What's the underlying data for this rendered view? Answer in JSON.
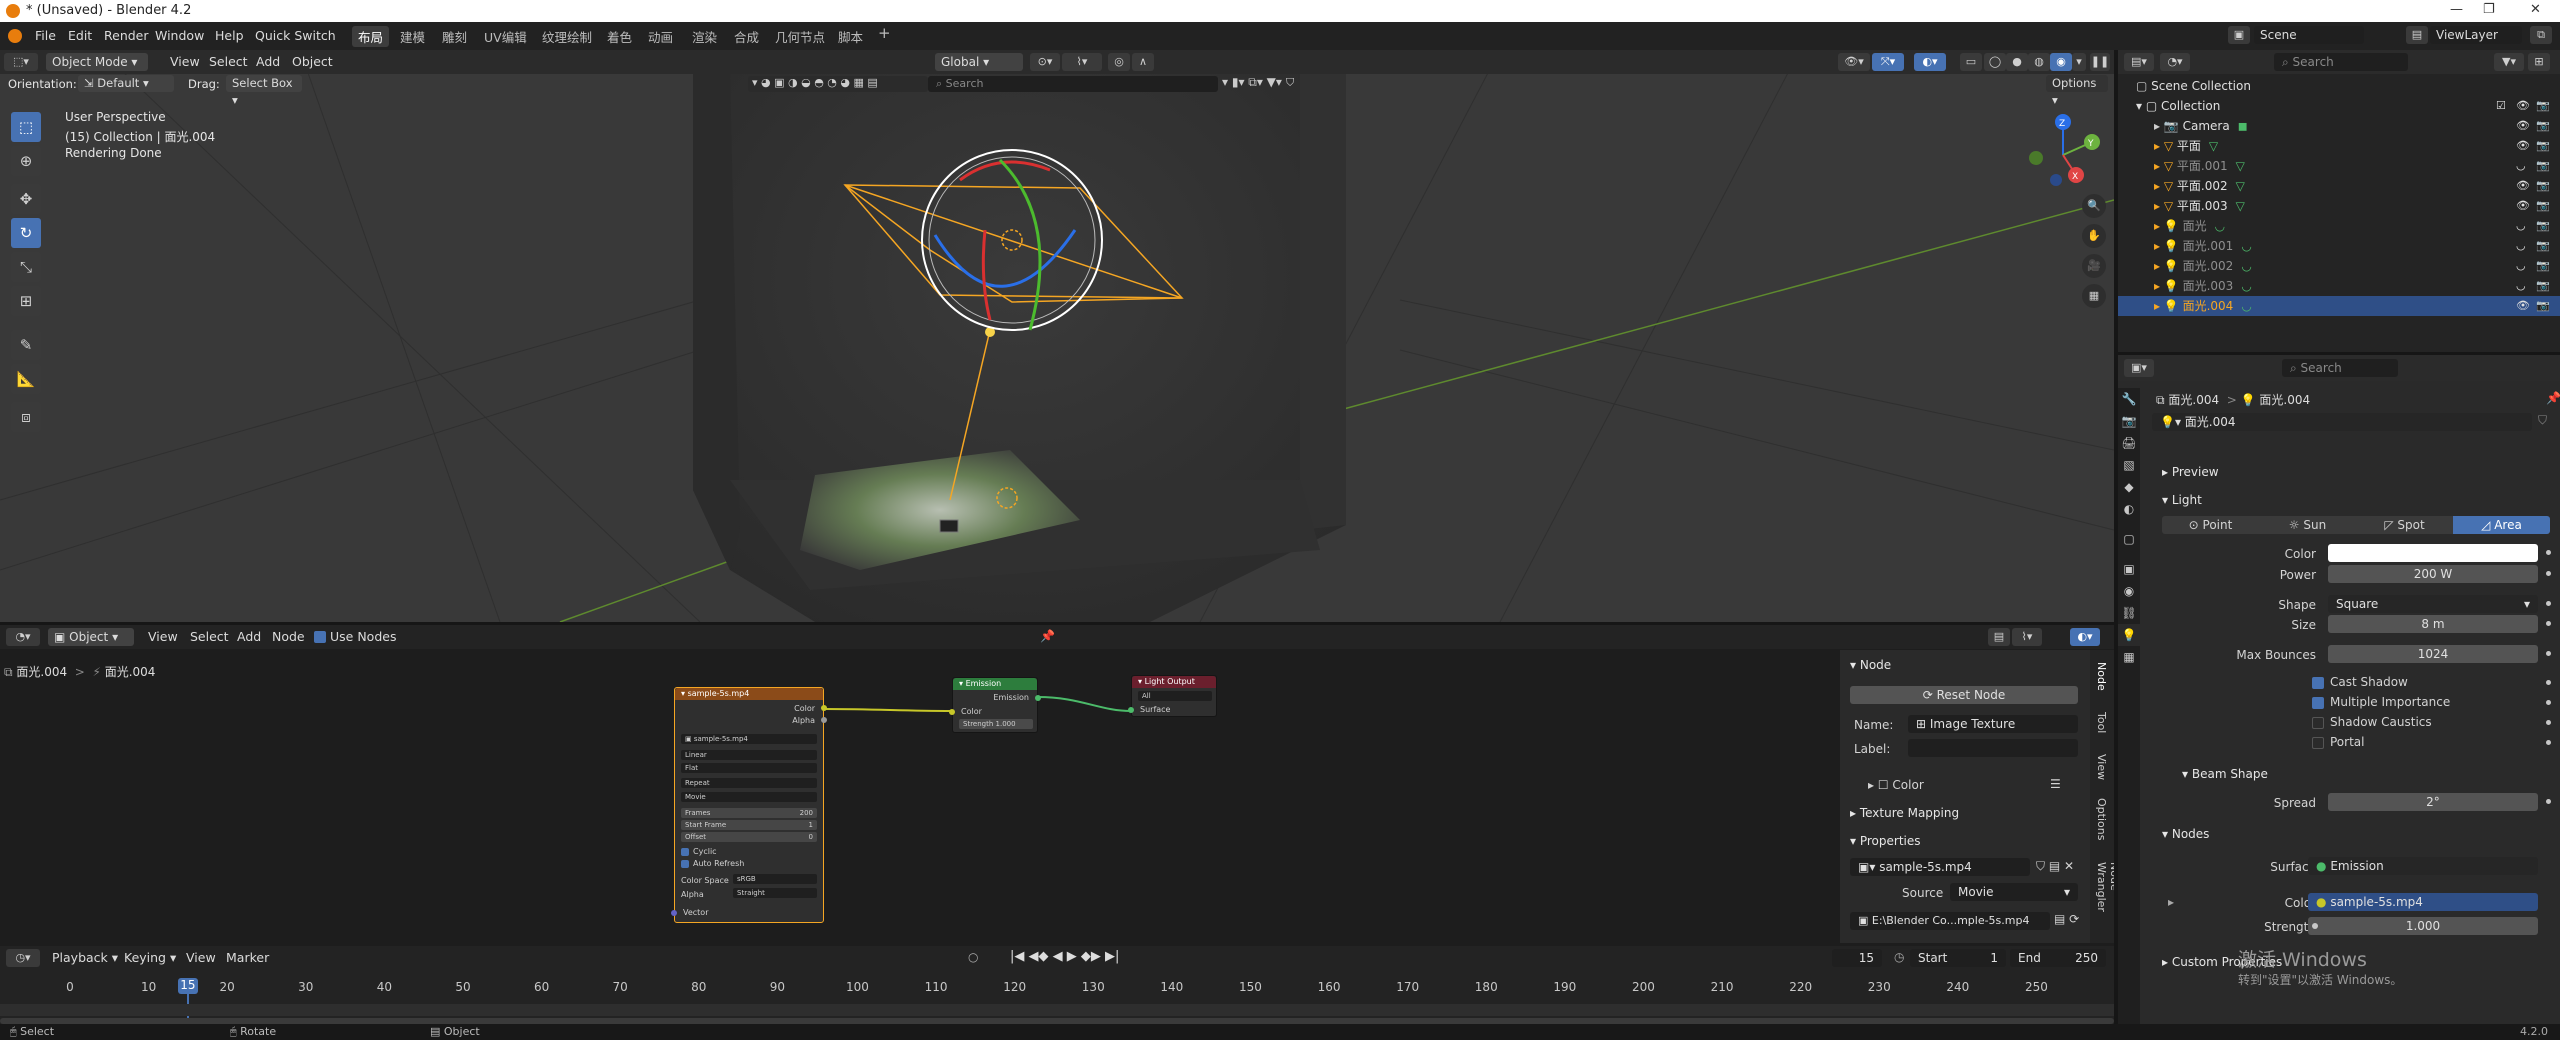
{
  "window": {
    "title": "* (Unsaved) - Blender 4.2"
  },
  "menubar": {
    "items": [
      "File",
      "Edit",
      "Render",
      "Window",
      "Help",
      "Quick Switch"
    ],
    "workspaces": [
      "布局",
      "建模",
      "雕刻",
      "UV编辑",
      "纹理绘制",
      "着色",
      "动画",
      "渲染",
      "合成",
      "几何节点",
      "脚本"
    ],
    "add_workspace": "+"
  },
  "viewport": {
    "mode": "Object Mode",
    "menus": [
      "View",
      "Select",
      "Add",
      "Object"
    ],
    "orientation_label": "Orientation:",
    "orientation_value": "Default",
    "drag_label": "Drag:",
    "drag_value": "Select Box",
    "transform_space": "Global",
    "search_placeholder": "Search",
    "options_label": "Options",
    "info_line1": "User Perspective",
    "info_line2": "(15) Collection | 面光.004",
    "info_line3": "Rendering Done",
    "axes": {
      "x": "X",
      "y": "Y",
      "z": "Z"
    }
  },
  "node_editor": {
    "object_mode": "Object",
    "menus": [
      "View",
      "Select",
      "Add",
      "Node"
    ],
    "use_nodes_label": "Use Nodes",
    "breadcrumb": [
      "面光.004",
      "面光.004"
    ],
    "image_node": {
      "title": "sample-5s.mp4",
      "outputs": [
        "Color",
        "Alpha"
      ],
      "image_name": "sample-5s.mp4",
      "interpolation": "Linear",
      "projection": "Flat",
      "extension": "Repeat",
      "source": "Movie",
      "frames_label": "Frames",
      "frames_value": "200",
      "start_frame_label": "Start Frame",
      "start_frame_value": "1",
      "offset_label": "Offset",
      "offset_value": "0",
      "cyclic_label": "Cyclic",
      "auto_refresh_label": "Auto Refresh",
      "color_space_label": "Color Space",
      "color_space_value": "sRGB",
      "alpha_label": "Alpha",
      "alpha_value": "Straight",
      "vector_label": "Vector"
    },
    "emission_node": {
      "title": "Emission",
      "output": "Emission",
      "color_label": "Color",
      "strength_label": "Strength",
      "strength_value": "1.000"
    },
    "output_node": {
      "title": "Light Output",
      "target": "All",
      "surface_label": "Surface"
    },
    "npanel": {
      "section": "Node",
      "reset_button": "Reset Node",
      "name_label": "Name:",
      "name_value": "Image Texture",
      "label_label": "Label:",
      "label_value": "",
      "color_section": "Color",
      "texture_mapping": "Texture Mapping",
      "properties_section": "Properties",
      "image_name": "sample-5s.mp4",
      "source_label": "Source",
      "source_value": "Movie",
      "filepath": "E:\\Blender Co...mple-5s.mp4",
      "tabs": [
        "Node",
        "Tool",
        "View",
        "Options",
        "Node Wrangler"
      ]
    }
  },
  "timeline": {
    "menus": [
      "Playback",
      "Keying",
      "View",
      "Marker"
    ],
    "current_frame": "15",
    "start_label": "Start",
    "start_value": "1",
    "end_label": "End",
    "end_value": "250",
    "ticks": [
      "0",
      "10",
      "15",
      "20",
      "30",
      "40",
      "50",
      "60",
      "70",
      "80",
      "90",
      "100",
      "110",
      "120",
      "130",
      "140",
      "150",
      "160",
      "170",
      "180",
      "190",
      "200",
      "210",
      "220",
      "230",
      "240",
      "250"
    ]
  },
  "statusbar": {
    "select": "Select",
    "rotate": "Rotate",
    "object": "Object",
    "version": "4.2.0"
  },
  "scene_header": {
    "scene": "Scene",
    "view_layer": "ViewLayer"
  },
  "outliner": {
    "search_placeholder": "Search",
    "scene_collection": "Scene Collection",
    "collection": "Collection",
    "items": [
      {
        "name": "Camera",
        "dim": false,
        "selected": false
      },
      {
        "name": "平面",
        "dim": false,
        "selected": false
      },
      {
        "name": "平面.001",
        "dim": true,
        "selected": false
      },
      {
        "name": "平面.002",
        "dim": false,
        "selected": false
      },
      {
        "name": "平面.003",
        "dim": false,
        "selected": false
      },
      {
        "name": "面光",
        "dim": true,
        "selected": false
      },
      {
        "name": "面光.001",
        "dim": true,
        "selected": false
      },
      {
        "name": "面光.002",
        "dim": true,
        "selected": false
      },
      {
        "name": "面光.003",
        "dim": true,
        "selected": false
      },
      {
        "name": "面光.004",
        "dim": false,
        "selected": true
      }
    ]
  },
  "properties": {
    "search_placeholder": "Search",
    "breadcrumb": [
      "面光.004",
      "面光.004"
    ],
    "datablock": "面光.004",
    "preview_section": "Preview",
    "light_section": "Light",
    "light_types": [
      "Point",
      "Sun",
      "Spot",
      "Area"
    ],
    "active_light_type": "Area",
    "color_label": "Color",
    "power_label": "Power",
    "power_value": "200 W",
    "shape_label": "Shape",
    "shape_value": "Square",
    "size_label": "Size",
    "size_value": "8 m",
    "max_bounces_label": "Max Bounces",
    "max_bounces_value": "1024",
    "checkboxes": [
      {
        "label": "Cast Shadow",
        "checked": true
      },
      {
        "label": "Multiple Importance",
        "checked": true
      },
      {
        "label": "Shadow Caustics",
        "checked": false
      },
      {
        "label": "Portal",
        "checked": false
      }
    ],
    "beam_shape_section": "Beam Shape",
    "spread_label": "Spread",
    "spread_value": "2°",
    "nodes_section": "Nodes",
    "surface_label": "Surface",
    "surface_value": "Emission",
    "node_color_label": "Color",
    "node_color_value": "sample-5s.mp4",
    "strength_label": "Strength",
    "strength_value": "1.000",
    "custom_props_section": "Custom Properties"
  },
  "watermark": {
    "line1": "激活 Windows",
    "line2": "转到\"设置\"以激活 Windows。"
  },
  "colors": {
    "accent": "#4772b3",
    "selection_orange": "#f5a623",
    "light_color": "#ffffff"
  }
}
